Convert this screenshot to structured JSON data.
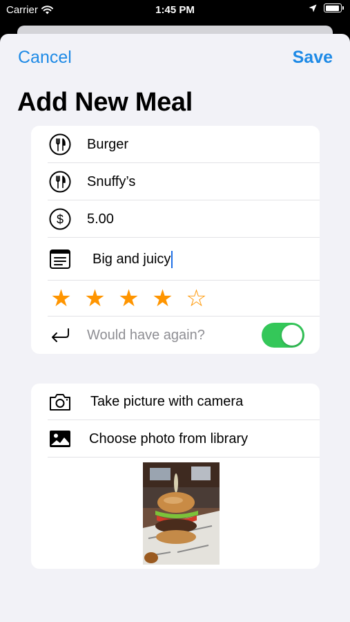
{
  "status_bar": {
    "carrier": "Carrier",
    "time": "1:45 PM",
    "battery_level": 0.95
  },
  "nav": {
    "cancel_label": "Cancel",
    "save_label": "Save"
  },
  "title": "Add New Meal",
  "form": {
    "name": {
      "value": "Burger",
      "icon": "fork-knife-circle-icon"
    },
    "restaurant": {
      "value": "Snuffy’s",
      "icon": "fork-knife-circle-icon"
    },
    "price": {
      "value": "5.00",
      "icon": "dollar-circle-icon"
    },
    "notes": {
      "value": "Big and juicy",
      "icon": "notes-icon"
    },
    "rating": {
      "value": 4,
      "max": 5
    },
    "would_have_again": {
      "label": "Would have again?",
      "on": true,
      "icon": "return-arrow-icon"
    }
  },
  "photo_section": {
    "camera_label": "Take picture with camera",
    "library_label": "Choose photo from library"
  },
  "colors": {
    "accent": "#1e8ae6",
    "star": "#ff9500",
    "toggle_on": "#34c759",
    "background": "#f2f2f7"
  }
}
